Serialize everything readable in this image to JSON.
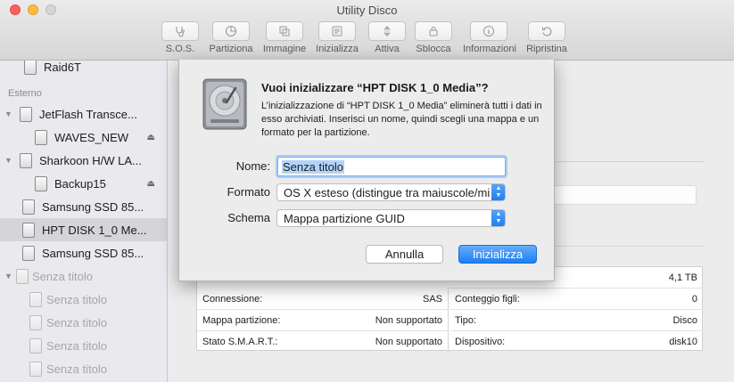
{
  "window": {
    "title": "Utility Disco"
  },
  "toolbar": {
    "items": [
      {
        "label": "S.O.S.",
        "icon": "stethoscope-icon"
      },
      {
        "label": "Partiziona",
        "icon": "pie-chart-icon"
      },
      {
        "label": "Immagine",
        "icon": "image-icon"
      },
      {
        "label": "Inizializza",
        "icon": "erase-icon"
      },
      {
        "label": "Attiva",
        "icon": "mount-icon"
      },
      {
        "label": "Sblocca",
        "icon": "lock-icon"
      },
      {
        "label": "Informazioni",
        "icon": "info-icon"
      },
      {
        "label": "Ripristina",
        "icon": "restore-icon"
      }
    ]
  },
  "sidebar": {
    "top_item": "Raid6T",
    "section": "Esterno",
    "items": [
      {
        "label": "JetFlash Transce...",
        "eject": false
      },
      {
        "label": "WAVES_NEW",
        "eject": true
      },
      {
        "label": "Sharkoon H/W LA...",
        "eject": false
      },
      {
        "label": "Backup15",
        "eject": true
      },
      {
        "label": "Samsung SSD 85...",
        "eject": false
      },
      {
        "label": "HPT DISK 1_0 Me...",
        "eject": false
      },
      {
        "label": "Samsung SSD 85...",
        "eject": false
      },
      {
        "label": "Senza titolo",
        "eject": false
      },
      {
        "label": "Senza titolo",
        "eject": false
      },
      {
        "label": "Senza titolo",
        "eject": false
      },
      {
        "label": "Senza titolo",
        "eject": false
      },
      {
        "label": "Senza titolo",
        "eject": false
      }
    ]
  },
  "info": {
    "capacity": "4,1 TB",
    "rows": [
      {
        "left_label": "Connessione:",
        "left_value": "SAS",
        "right_label": "Conteggio figli:",
        "right_value": "0"
      },
      {
        "left_label": "Mappa partizione:",
        "left_value": "Non supportato",
        "right_label": "Tipo:",
        "right_value": "Disco"
      },
      {
        "left_label": "Stato S.M.A.R.T.:",
        "left_value": "Non supportato",
        "right_label": "Dispositivo:",
        "right_value": "disk10"
      }
    ]
  },
  "dialog": {
    "title": "Vuoi inizializzare “HPT DISK 1_0 Media”?",
    "message": "L’inizializzazione di “HPT DISK 1_0 Media” eliminerà tutti i dati in esso archiviati. Inserisci un nome, quindi scegli una mappa e un formato per la partizione.",
    "name_label": "Nome:",
    "name_value": "Senza titolo",
    "format_label": "Formato",
    "format_value": "OS X esteso (distingue tra maiuscole/minuscole, journaled)",
    "scheme_label": "Schema",
    "scheme_value": "Mappa partizione GUID",
    "cancel_label": "Annulla",
    "ok_label": "Inizializza"
  },
  "colors": {
    "accent": "#1c7ff3",
    "selection": "#b3d3fb"
  }
}
